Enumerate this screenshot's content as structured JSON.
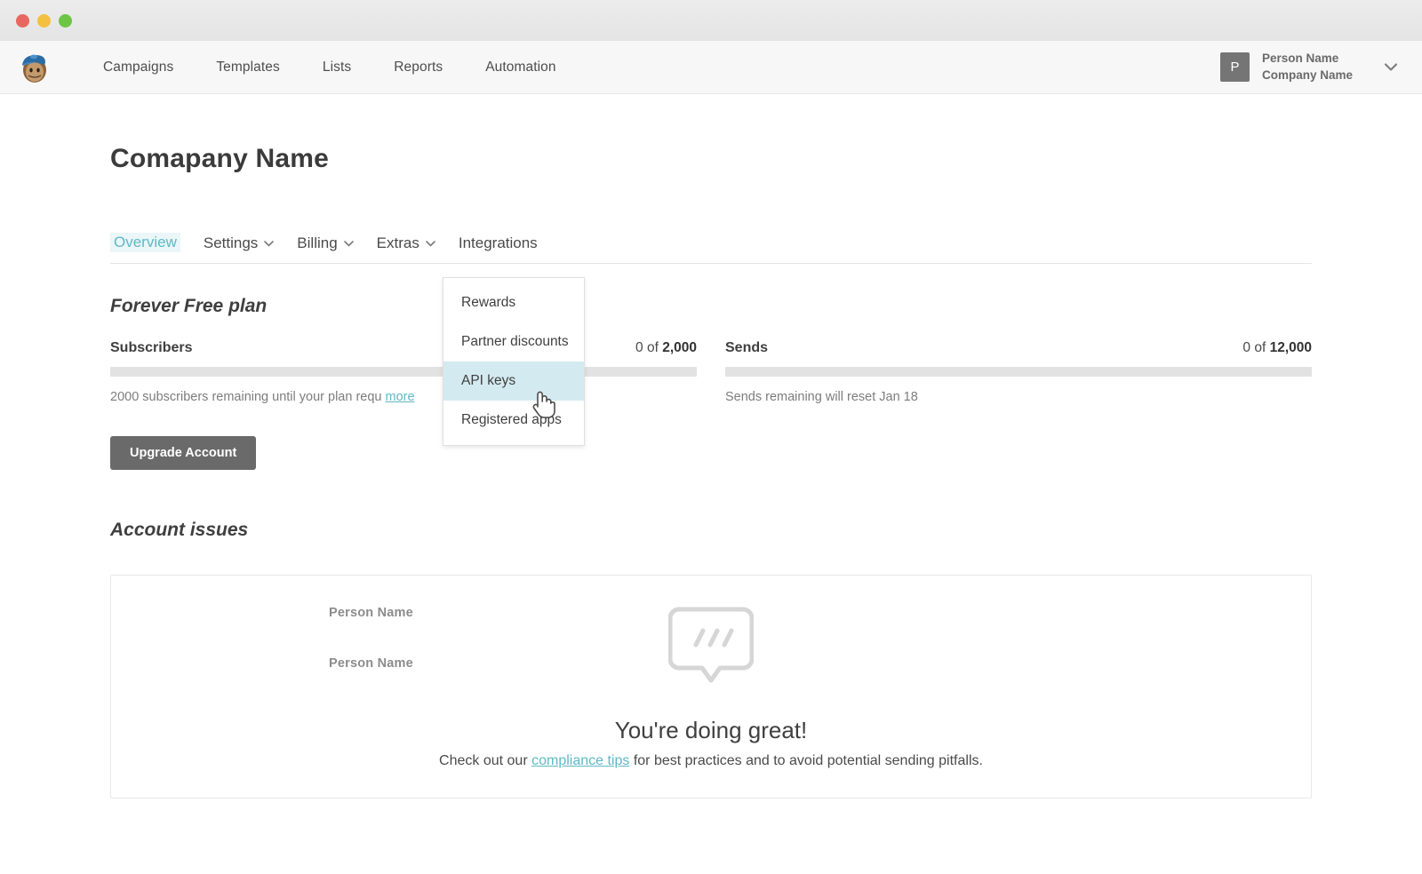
{
  "window": {
    "traffic_lights": [
      "close",
      "minimize",
      "maximize"
    ],
    "colors": {
      "close": "#e8685f",
      "minimize": "#f4c03f",
      "maximize": "#6cc644"
    }
  },
  "header": {
    "logo_name": "mailchimp-freddie-logo",
    "nav": [
      {
        "label": "Campaigns"
      },
      {
        "label": "Templates"
      },
      {
        "label": "Lists"
      },
      {
        "label": "Reports"
      },
      {
        "label": "Automation"
      }
    ],
    "account": {
      "avatar_initial": "P",
      "person_name": "Person Name",
      "company_name": "Company Name",
      "chevron": "⌄"
    }
  },
  "page": {
    "title": "Comapany Name",
    "tabs": [
      {
        "label": "Overview",
        "active": true,
        "has_caret": false
      },
      {
        "label": "Settings",
        "active": false,
        "has_caret": true
      },
      {
        "label": "Billing",
        "active": false,
        "has_caret": true
      },
      {
        "label": "Extras",
        "active": false,
        "has_caret": true
      },
      {
        "label": "Integrations",
        "active": false,
        "has_caret": false
      }
    ]
  },
  "plan": {
    "name": "Forever Free plan",
    "subscribers": {
      "label": "Subscribers",
      "count": "0 of ",
      "count_total": "2,000",
      "progress_percent": 0,
      "note": "2000 subscribers remaining until your plan requ",
      "note_link": "more"
    },
    "sends": {
      "label": "Sends",
      "count": "0 of ",
      "count_total": "12,000",
      "progress_percent": 0,
      "note": "Sends remaining will reset Jan 18"
    },
    "upgrade_button": "Upgrade Account"
  },
  "extras_dropdown": {
    "items": [
      {
        "label": "Rewards",
        "highlighted": false
      },
      {
        "label": "Partner discounts",
        "highlighted": false
      },
      {
        "label": "API keys",
        "highlighted": true
      },
      {
        "label": "Registered apps",
        "highlighted": false
      }
    ],
    "highlight_color": "#d3eaf0"
  },
  "ghost_labels": [
    {
      "text": "Person Name"
    },
    {
      "text": "Person Name"
    }
  ],
  "account_issues": {
    "section_title": "Account issues",
    "empty_icon": "speech-bubble-icon",
    "empty_title": "You're doing great!",
    "empty_sub_before": "Check out our ",
    "empty_sub_link": "compliance tips",
    "empty_sub_after": " for best practices and to avoid potential sending pitfalls."
  },
  "theme": {
    "accent": "#5fb8c6",
    "text": "#3f3f3f",
    "muted": "#7d7d7d",
    "bar_track": "#e2e2e2"
  }
}
